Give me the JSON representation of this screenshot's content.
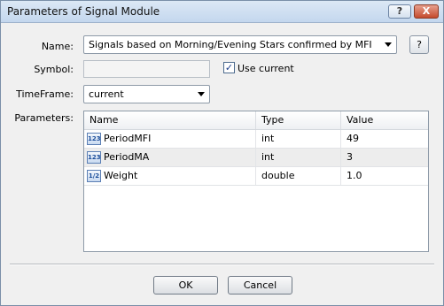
{
  "window": {
    "title": "Parameters of Signal Module",
    "help_btn": "?",
    "close_btn": "X"
  },
  "form": {
    "name_label": "Name:",
    "name_value": "Signals based on Morning/Evening Stars confirmed by MFI",
    "name_help": "?",
    "symbol_label": "Symbol:",
    "symbol_value": "",
    "use_current_label": "Use current",
    "use_current_checked": true,
    "timeframe_label": "TimeFrame:",
    "timeframe_value": "current",
    "parameters_label": "Parameters:"
  },
  "grid": {
    "columns": [
      "Name",
      "Type",
      "Value"
    ],
    "rows": [
      {
        "icon": "integer-param-icon",
        "icon_text": "123",
        "name": "PeriodMFI",
        "type": "int",
        "value": "49"
      },
      {
        "icon": "integer-param-icon",
        "icon_text": "123",
        "name": "PeriodMA",
        "type": "int",
        "value": "3"
      },
      {
        "icon": "double-param-icon",
        "icon_text": "1/2",
        "name": "Weight",
        "type": "double",
        "value": "1.0"
      }
    ]
  },
  "buttons": {
    "ok": "OK",
    "cancel": "Cancel"
  }
}
